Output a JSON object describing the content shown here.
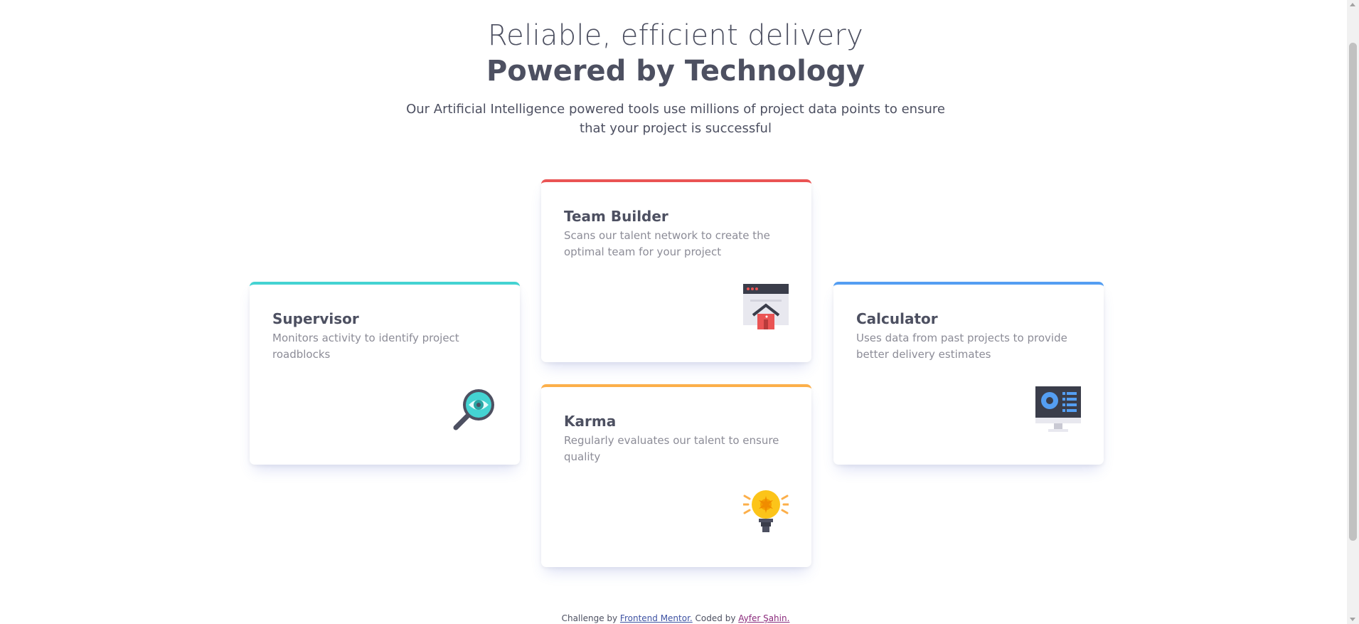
{
  "header": {
    "title_light": "Reliable, efficient delivery",
    "title_bold": "Powered by Technology",
    "description": "Our Artificial Intelligence powered tools use millions of project data points to ensure that your project is successful"
  },
  "cards": {
    "supervisor": {
      "title": "Supervisor",
      "text": "Monitors activity to identify project roadblocks",
      "icon": "magnifier-eye-icon",
      "accent": "#44d3d2"
    },
    "team_builder": {
      "title": "Team Builder",
      "text": "Scans our talent network to create the optimal team for your project",
      "icon": "browser-house-icon",
      "accent": "#ea5454"
    },
    "karma": {
      "title": "Karma",
      "text": "Regularly evaluates our talent to ensure quality",
      "icon": "lightbulb-icon",
      "accent": "#fcaf4a"
    },
    "calculator": {
      "title": "Calculator",
      "text": "Uses data from past projects to provide better delivery estimates",
      "icon": "monitor-chart-icon",
      "accent": "#549ef2"
    }
  },
  "footer": {
    "prefix": "Challenge by ",
    "frontend_mentor": "Frontend Mentor.",
    "middle": " Coded by ",
    "author": "Ayfer Şahin."
  }
}
